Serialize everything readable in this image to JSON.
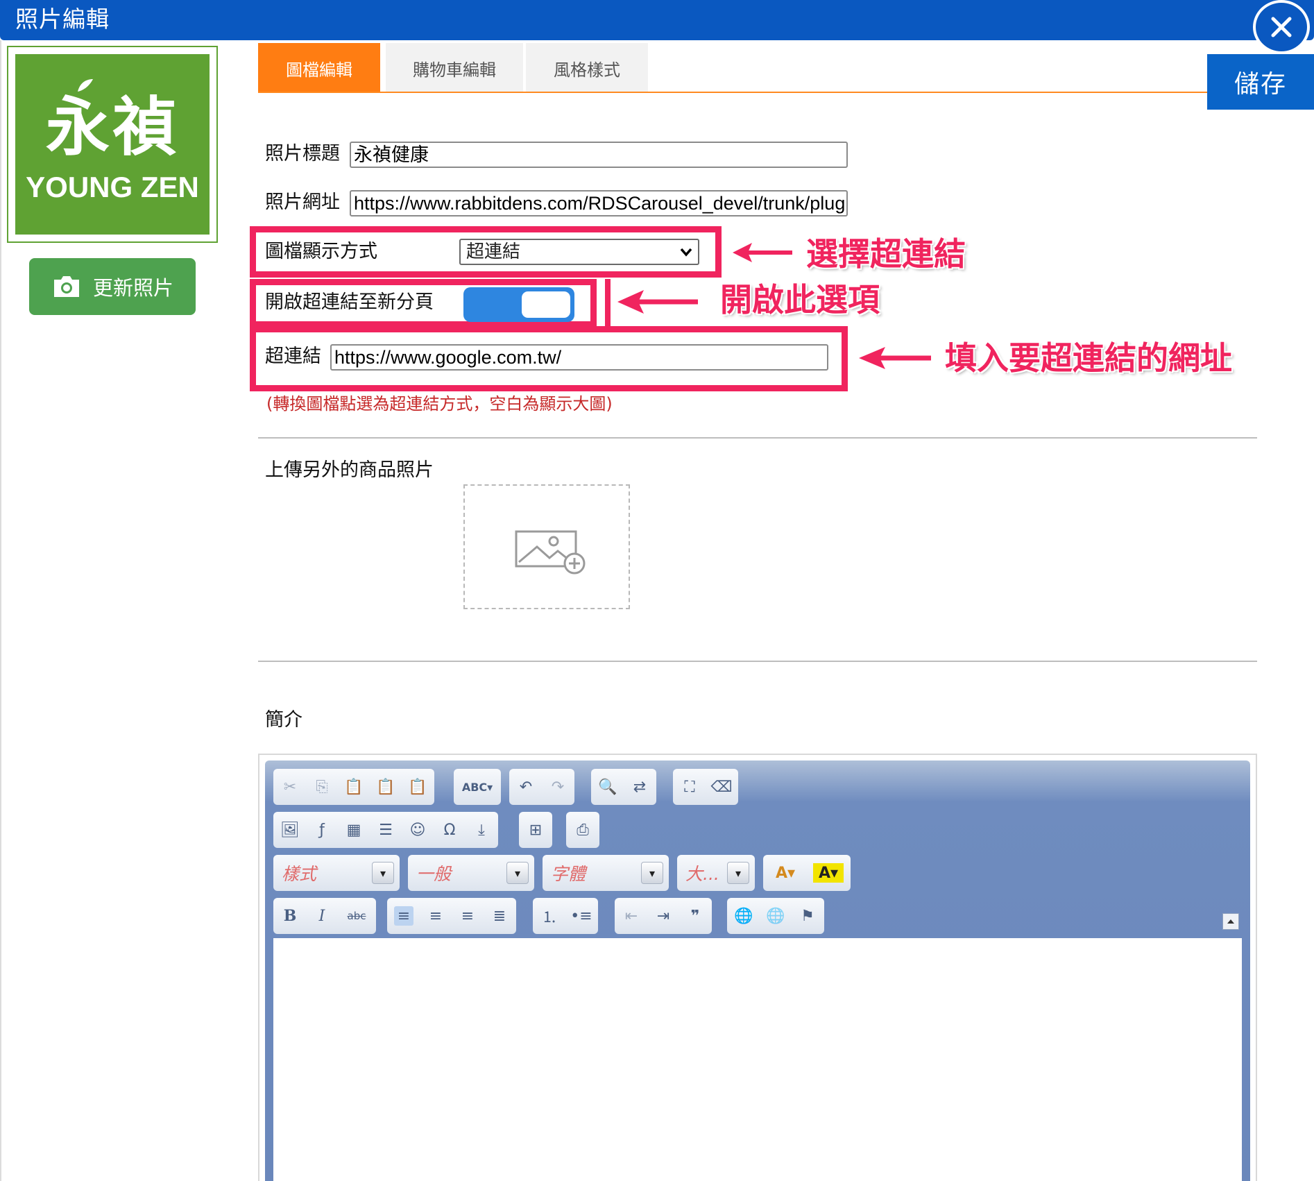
{
  "window": {
    "title": "照片編輯"
  },
  "sidebar": {
    "logo_cn": "永禎",
    "logo_en": "YOUNG ZEN",
    "update_photo_label": "更新照片"
  },
  "tabs": [
    {
      "label": "圖檔編輯",
      "active": true
    },
    {
      "label": "購物車編輯",
      "active": false
    },
    {
      "label": "風格樣式",
      "active": false
    }
  ],
  "save_label": "儲存",
  "form": {
    "photo_title_label": "照片標題",
    "photo_title_value": "永禎健康",
    "photo_url_label": "照片網址",
    "photo_url_value": "https://www.rabbitdens.com/RDSCarousel_devel/trunk/plugii",
    "display_mode_label": "圖檔顯示方式",
    "display_mode_value": "超連結",
    "new_tab_label": "開啟超連結至新分頁",
    "new_tab_on": true,
    "hyperlink_label": "超連結",
    "hyperlink_value": "https://www.google.com.tw/",
    "hint": "(轉換圖檔點選為超連結方式，空白為顯示大圖)"
  },
  "annotations": {
    "a1": "選擇超連結",
    "a2": "開啟此選項",
    "a3": "填入要超連結的網址"
  },
  "upload": {
    "label": "上傳另外的商品照片"
  },
  "intro": {
    "label": "簡介"
  },
  "editor": {
    "style_combo": "樣式",
    "format_combo": "一般",
    "font_combo": "字體",
    "size_combo": "大..."
  },
  "colors": {
    "titlebar": "#0a58c0",
    "tab_active": "#ff7d12",
    "annotation": "#f0245e",
    "logo_green": "#5fa233",
    "update_button": "#4ea24f"
  }
}
